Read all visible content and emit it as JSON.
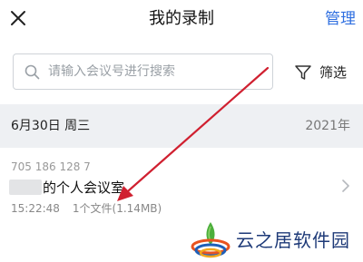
{
  "header": {
    "close_icon": "close-icon",
    "title": "我的录制",
    "manage_label": "管理"
  },
  "search": {
    "icon": "search-icon",
    "placeholder": "请输入会议号进行搜索",
    "value": ""
  },
  "filter": {
    "icon": "filter-icon",
    "label": "筛选"
  },
  "date_group": {
    "date": "6月30日 周三",
    "year": "2021年"
  },
  "records": [
    {
      "meeting_id": "705 186 128 7",
      "title": "的个人会议室",
      "time": "15:22:48",
      "files": "1个文件(1.14MB)",
      "chevron_icon": "chevron-right-icon"
    }
  ],
  "watermark": {
    "text": "云之居软件园"
  },
  "colors": {
    "accent": "#2f6fe0",
    "annotation_arrow": "#d02030",
    "date_bar_bg": "#eef0f3"
  }
}
